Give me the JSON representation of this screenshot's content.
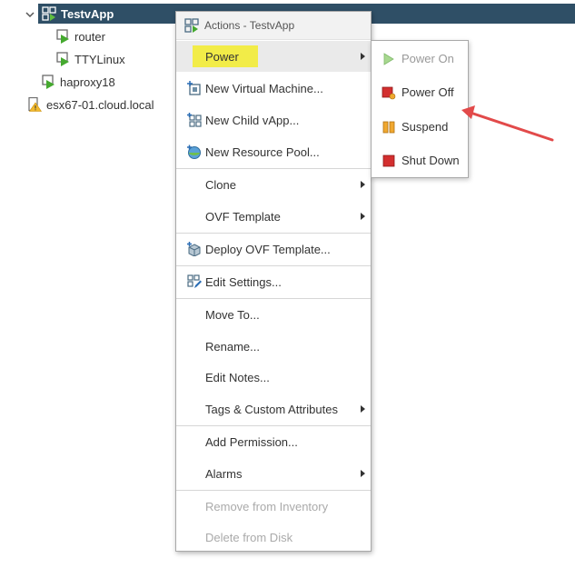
{
  "tree": {
    "items": [
      {
        "label": "TestvApp",
        "icon": "vapp-icon",
        "selected": true
      },
      {
        "label": "router",
        "icon": "vm-powered-on-icon"
      },
      {
        "label": "TTYLinux",
        "icon": "vm-powered-on-icon"
      },
      {
        "label": "haproxy18",
        "icon": "vm-powered-on-icon"
      },
      {
        "label": "esx67-01.cloud.local",
        "icon": "host-warning-icon"
      }
    ]
  },
  "context_menu": {
    "header": "Actions - TestvApp",
    "items": [
      {
        "label": "Power",
        "submenu": true,
        "highlighted": true
      },
      {
        "label": "New Virtual Machine...",
        "icon": "new-vm-icon"
      },
      {
        "label": "New Child vApp...",
        "icon": "new-vapp-icon"
      },
      {
        "label": "New Resource Pool...",
        "icon": "resource-pool-icon"
      },
      {
        "label": "Clone",
        "submenu": true
      },
      {
        "label": "OVF Template",
        "submenu": true
      },
      {
        "label": "Deploy OVF Template...",
        "icon": "deploy-ovf-icon"
      },
      {
        "label": "Edit Settings...",
        "icon": "edit-settings-icon"
      },
      {
        "label": "Move To..."
      },
      {
        "label": "Rename..."
      },
      {
        "label": "Edit Notes..."
      },
      {
        "label": "Tags & Custom Attributes",
        "submenu": true
      },
      {
        "label": "Add Permission..."
      },
      {
        "label": "Alarms",
        "submenu": true
      },
      {
        "label": "Remove from Inventory",
        "disabled": true
      },
      {
        "label": "Delete from Disk",
        "disabled": true
      }
    ]
  },
  "power_submenu": {
    "items": [
      {
        "label": "Power On",
        "icon": "power-on-icon",
        "disabled": true
      },
      {
        "label": "Power Off",
        "icon": "power-off-icon"
      },
      {
        "label": "Suspend",
        "icon": "suspend-icon"
      },
      {
        "label": "Shut Down",
        "icon": "shut-down-icon"
      }
    ]
  },
  "colors": {
    "selection": "#2f4f66",
    "highlight": "#f2ec48",
    "annotation_arrow": "#e24a4a",
    "power_on": "#9ccc65",
    "power_off": "#d32f2f",
    "suspend": "#f0a830"
  }
}
